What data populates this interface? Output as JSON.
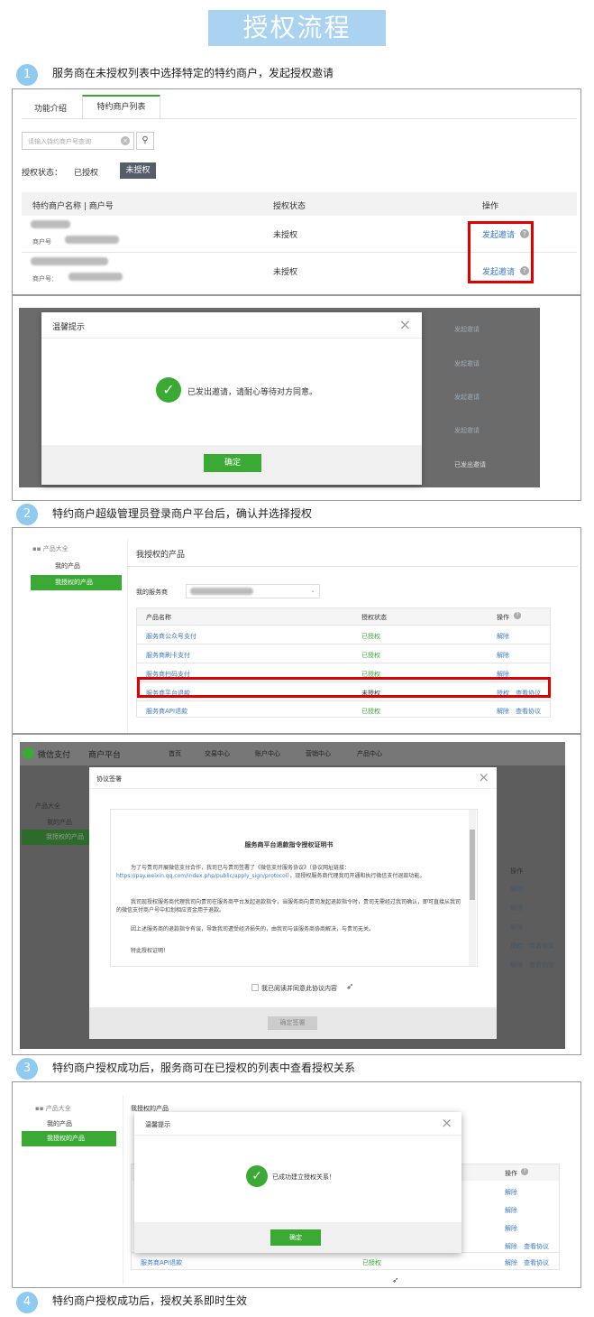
{
  "title": "授权流程",
  "steps": [
    {
      "num": "1",
      "text": "服务商在未授权列表中选择特定的特约商户，发起授权邀请"
    },
    {
      "num": "2",
      "text": "特约商户超级管理员登录商户平台后，确认并选择授权"
    },
    {
      "num": "3",
      "text": "特约商户授权成功后，服务商可在已授权的列表中查看授权关系"
    },
    {
      "num": "4",
      "text": "特约商户授权成功后，授权关系即时生效"
    }
  ],
  "s1": {
    "tabs": [
      "功能介绍",
      "特约商户列表"
    ],
    "search_placeholder": "请输入特约商户号查询",
    "filter_label": "授权状态：",
    "filter_authorized": "已授权",
    "filter_unauthorized": "未授权",
    "col_name": "特约商户名称 | 商户号",
    "col_status": "授权状态",
    "col_action": "操作",
    "merchant_no_label": "商户号",
    "merchant_no_label2": "商户号：",
    "row_status": "未授权",
    "row_action": "发起邀请"
  },
  "s1b": {
    "dialog_title": "温馨提示",
    "message": "已发出邀请，请耐心等待对方同意。",
    "ok": "确定",
    "bg_action": "发起邀请",
    "bg_sent": "已发出邀请"
  },
  "s2": {
    "sidebar_title": "产品大全",
    "sidebar_my": "我的产品",
    "sidebar_auth": "我授权的产品",
    "page_title": "我授权的产品",
    "provider_label": "我的服务商",
    "col_name": "产品名称",
    "col_status": "授权状态",
    "col_action": "操作",
    "rows": [
      {
        "name": "服务商公众号支付",
        "status": "已授权",
        "a1": "解除",
        "a2": ""
      },
      {
        "name": "服务商刷卡支付",
        "status": "已授权",
        "a1": "解除",
        "a2": ""
      },
      {
        "name": "服务商扫码支付",
        "status": "已授权",
        "a1": "解除",
        "a2": ""
      },
      {
        "name": "服务商平台退款",
        "status": "未授权",
        "a1": "授权",
        "a2": "查看协议"
      },
      {
        "name": "服务商API退款",
        "status": "已授权",
        "a1": "解除",
        "a2": "查看协议"
      }
    ]
  },
  "s2b": {
    "brand": "微信支付",
    "platform": "商户平台",
    "nav": [
      "首页",
      "交易中心",
      "账户中心",
      "营销中心",
      "产品中心"
    ],
    "sidebar_title": "产品大全",
    "sidebar_my": "我的产品",
    "sidebar_auth": "我授权的产品",
    "bg_action": "操作",
    "bg_rows": [
      "解除",
      "解除",
      "解除",
      "授权",
      "解除"
    ],
    "bg_view": "查看协议",
    "dialog_title": "协议签署",
    "doc_title": "服务商平台退款指令授权证明书",
    "p1a": "为了与贵司开展微信支付合作，我司已与贵司签署了《微信支付服务协议》（协议网址链接：",
    "p1link": "https://pay.weixin.qq.com/index.php/public/apply_sign/protocol",
    "p1b": "），现授权服务商代理我司开通和执行微信支付退款功能。",
    "p2": "我司现授权服务商代理我司向贵司在服务商平台发起退款指令，当服务商向贵司发起退款指令时，贵司无需经过我司确认，即可直接从我司的微信支付商户号中扣划相应资金用于退款。",
    "p3": "因上述服务商的退款指令有误，导致我司遭受经济损失的，由我司与该服务商协商解决，与贵司无关。",
    "p4": "特此授权证明！",
    "agree": "我已阅读并同意此协议内容",
    "confirm": "确定签署"
  },
  "s3": {
    "sidebar_title": "产品大全",
    "sidebar_my": "我的产品",
    "sidebar_auth": "我授权的产品",
    "page_title": "我授权的产品",
    "bg_col_action": "操作",
    "bg_rows": [
      "解除",
      "解除",
      "解除",
      "解除",
      "解除"
    ],
    "bg_view": "查看协议",
    "bg_last_name": "服务商API退款",
    "bg_last_status": "已授权",
    "dialog_title": "温馨提示",
    "message": "已成功建立授权关系！",
    "ok": "确定"
  },
  "colors": {
    "accent_blue": "#a9d3f0",
    "green": "#3aaa35",
    "red": "#e00000",
    "link": "#3b7ac9"
  }
}
